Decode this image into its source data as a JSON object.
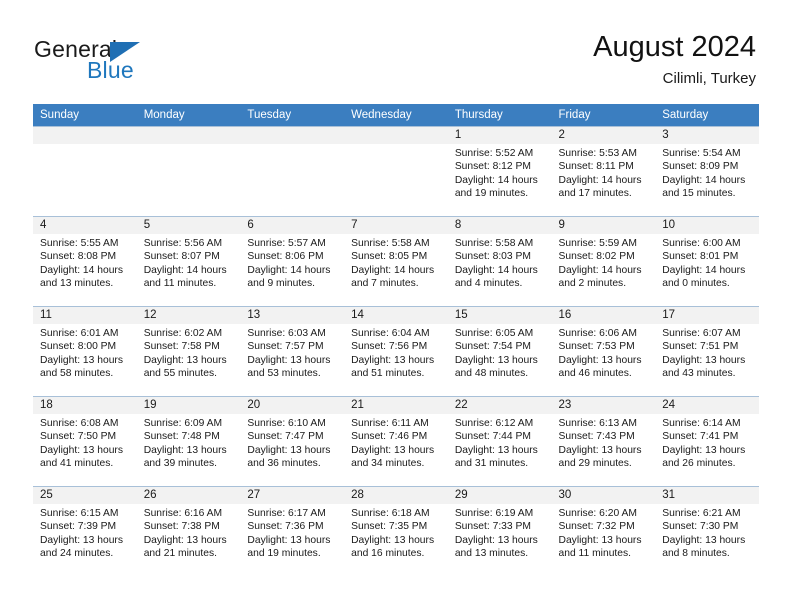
{
  "brand": {
    "name_part1": "General",
    "name_part2": "Blue",
    "triangle_icon": "triangle-icon",
    "accent_color": "#1f6fb4"
  },
  "header": {
    "title": "August 2024",
    "subtitle": "Cilimli, Turkey"
  },
  "calendar": {
    "header_bg": "#3b7ec0",
    "daynum_bg": "#f2f2f2",
    "columns": [
      "Sunday",
      "Monday",
      "Tuesday",
      "Wednesday",
      "Thursday",
      "Friday",
      "Saturday"
    ],
    "weeks": [
      [
        {
          "day": "",
          "empty": true
        },
        {
          "day": "",
          "empty": true
        },
        {
          "day": "",
          "empty": true
        },
        {
          "day": "",
          "empty": true
        },
        {
          "day": "1",
          "sunrise": "Sunrise: 5:52 AM",
          "sunset": "Sunset: 8:12 PM",
          "daylight": "Daylight: 14 hours and 19 minutes."
        },
        {
          "day": "2",
          "sunrise": "Sunrise: 5:53 AM",
          "sunset": "Sunset: 8:11 PM",
          "daylight": "Daylight: 14 hours and 17 minutes."
        },
        {
          "day": "3",
          "sunrise": "Sunrise: 5:54 AM",
          "sunset": "Sunset: 8:09 PM",
          "daylight": "Daylight: 14 hours and 15 minutes."
        }
      ],
      [
        {
          "day": "4",
          "sunrise": "Sunrise: 5:55 AM",
          "sunset": "Sunset: 8:08 PM",
          "daylight": "Daylight: 14 hours and 13 minutes."
        },
        {
          "day": "5",
          "sunrise": "Sunrise: 5:56 AM",
          "sunset": "Sunset: 8:07 PM",
          "daylight": "Daylight: 14 hours and 11 minutes."
        },
        {
          "day": "6",
          "sunrise": "Sunrise: 5:57 AM",
          "sunset": "Sunset: 8:06 PM",
          "daylight": "Daylight: 14 hours and 9 minutes."
        },
        {
          "day": "7",
          "sunrise": "Sunrise: 5:58 AM",
          "sunset": "Sunset: 8:05 PM",
          "daylight": "Daylight: 14 hours and 7 minutes."
        },
        {
          "day": "8",
          "sunrise": "Sunrise: 5:58 AM",
          "sunset": "Sunset: 8:03 PM",
          "daylight": "Daylight: 14 hours and 4 minutes."
        },
        {
          "day": "9",
          "sunrise": "Sunrise: 5:59 AM",
          "sunset": "Sunset: 8:02 PM",
          "daylight": "Daylight: 14 hours and 2 minutes."
        },
        {
          "day": "10",
          "sunrise": "Sunrise: 6:00 AM",
          "sunset": "Sunset: 8:01 PM",
          "daylight": "Daylight: 14 hours and 0 minutes."
        }
      ],
      [
        {
          "day": "11",
          "sunrise": "Sunrise: 6:01 AM",
          "sunset": "Sunset: 8:00 PM",
          "daylight": "Daylight: 13 hours and 58 minutes."
        },
        {
          "day": "12",
          "sunrise": "Sunrise: 6:02 AM",
          "sunset": "Sunset: 7:58 PM",
          "daylight": "Daylight: 13 hours and 55 minutes."
        },
        {
          "day": "13",
          "sunrise": "Sunrise: 6:03 AM",
          "sunset": "Sunset: 7:57 PM",
          "daylight": "Daylight: 13 hours and 53 minutes."
        },
        {
          "day": "14",
          "sunrise": "Sunrise: 6:04 AM",
          "sunset": "Sunset: 7:56 PM",
          "daylight": "Daylight: 13 hours and 51 minutes."
        },
        {
          "day": "15",
          "sunrise": "Sunrise: 6:05 AM",
          "sunset": "Sunset: 7:54 PM",
          "daylight": "Daylight: 13 hours and 48 minutes."
        },
        {
          "day": "16",
          "sunrise": "Sunrise: 6:06 AM",
          "sunset": "Sunset: 7:53 PM",
          "daylight": "Daylight: 13 hours and 46 minutes."
        },
        {
          "day": "17",
          "sunrise": "Sunrise: 6:07 AM",
          "sunset": "Sunset: 7:51 PM",
          "daylight": "Daylight: 13 hours and 43 minutes."
        }
      ],
      [
        {
          "day": "18",
          "sunrise": "Sunrise: 6:08 AM",
          "sunset": "Sunset: 7:50 PM",
          "daylight": "Daylight: 13 hours and 41 minutes."
        },
        {
          "day": "19",
          "sunrise": "Sunrise: 6:09 AM",
          "sunset": "Sunset: 7:48 PM",
          "daylight": "Daylight: 13 hours and 39 minutes."
        },
        {
          "day": "20",
          "sunrise": "Sunrise: 6:10 AM",
          "sunset": "Sunset: 7:47 PM",
          "daylight": "Daylight: 13 hours and 36 minutes."
        },
        {
          "day": "21",
          "sunrise": "Sunrise: 6:11 AM",
          "sunset": "Sunset: 7:46 PM",
          "daylight": "Daylight: 13 hours and 34 minutes."
        },
        {
          "day": "22",
          "sunrise": "Sunrise: 6:12 AM",
          "sunset": "Sunset: 7:44 PM",
          "daylight": "Daylight: 13 hours and 31 minutes."
        },
        {
          "day": "23",
          "sunrise": "Sunrise: 6:13 AM",
          "sunset": "Sunset: 7:43 PM",
          "daylight": "Daylight: 13 hours and 29 minutes."
        },
        {
          "day": "24",
          "sunrise": "Sunrise: 6:14 AM",
          "sunset": "Sunset: 7:41 PM",
          "daylight": "Daylight: 13 hours and 26 minutes."
        }
      ],
      [
        {
          "day": "25",
          "sunrise": "Sunrise: 6:15 AM",
          "sunset": "Sunset: 7:39 PM",
          "daylight": "Daylight: 13 hours and 24 minutes."
        },
        {
          "day": "26",
          "sunrise": "Sunrise: 6:16 AM",
          "sunset": "Sunset: 7:38 PM",
          "daylight": "Daylight: 13 hours and 21 minutes."
        },
        {
          "day": "27",
          "sunrise": "Sunrise: 6:17 AM",
          "sunset": "Sunset: 7:36 PM",
          "daylight": "Daylight: 13 hours and 19 minutes."
        },
        {
          "day": "28",
          "sunrise": "Sunrise: 6:18 AM",
          "sunset": "Sunset: 7:35 PM",
          "daylight": "Daylight: 13 hours and 16 minutes."
        },
        {
          "day": "29",
          "sunrise": "Sunrise: 6:19 AM",
          "sunset": "Sunset: 7:33 PM",
          "daylight": "Daylight: 13 hours and 13 minutes."
        },
        {
          "day": "30",
          "sunrise": "Sunrise: 6:20 AM",
          "sunset": "Sunset: 7:32 PM",
          "daylight": "Daylight: 13 hours and 11 minutes."
        },
        {
          "day": "31",
          "sunrise": "Sunrise: 6:21 AM",
          "sunset": "Sunset: 7:30 PM",
          "daylight": "Daylight: 13 hours and 8 minutes."
        }
      ]
    ]
  }
}
